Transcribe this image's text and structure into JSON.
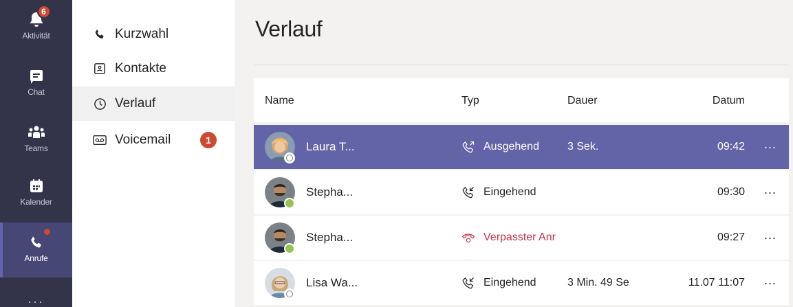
{
  "rail": {
    "items": [
      {
        "label": "Aktivität",
        "icon": "bell-icon",
        "badge": "6"
      },
      {
        "label": "Chat",
        "icon": "chat-icon"
      },
      {
        "label": "Teams",
        "icon": "teams-icon"
      },
      {
        "label": "Kalender",
        "icon": "calendar-icon"
      },
      {
        "label": "Anrufe",
        "icon": "phone-icon",
        "active": true
      }
    ],
    "more": "..."
  },
  "calls_nav": {
    "items": [
      {
        "label": "Kurzwahl",
        "icon": "phone-icon"
      },
      {
        "label": "Kontakte",
        "icon": "contacts-icon"
      },
      {
        "label": "Verlauf",
        "icon": "clock-icon",
        "active": true
      },
      {
        "label": "Voicemail",
        "icon": "voicemail-icon",
        "badge": "1"
      }
    ]
  },
  "main": {
    "title": "Verlauf",
    "columns": {
      "name": "Name",
      "type": "Typ",
      "duration": "Dauer",
      "date": "Datum"
    },
    "rows": [
      {
        "name": "Laura T...",
        "type": "Ausgehend",
        "type_icon": "outgoing-call-icon",
        "duration": "3 Sek.",
        "date": "09:42",
        "presence": "offline",
        "selected": true
      },
      {
        "name": "Stepha...",
        "type": "Eingehend",
        "type_icon": "incoming-call-icon",
        "duration": "",
        "date": "09:30",
        "presence": "available"
      },
      {
        "name": "Stepha...",
        "type": "Verpasster Anr",
        "type_icon": "missed-call-icon",
        "duration": "",
        "date": "09:27",
        "presence": "available",
        "missed": true
      },
      {
        "name": "Lisa Wa...",
        "type": "Eingehend",
        "type_icon": "incoming-call-icon",
        "duration": "3 Min. 49 Se",
        "date": "11.07 11:07",
        "presence": "offline"
      }
    ],
    "more": "..."
  },
  "colors": {
    "rail_bg": "#33344a",
    "accent": "#6264a7",
    "badge": "#cc4a31",
    "missed": "#c4314b",
    "available": "#92c353"
  }
}
